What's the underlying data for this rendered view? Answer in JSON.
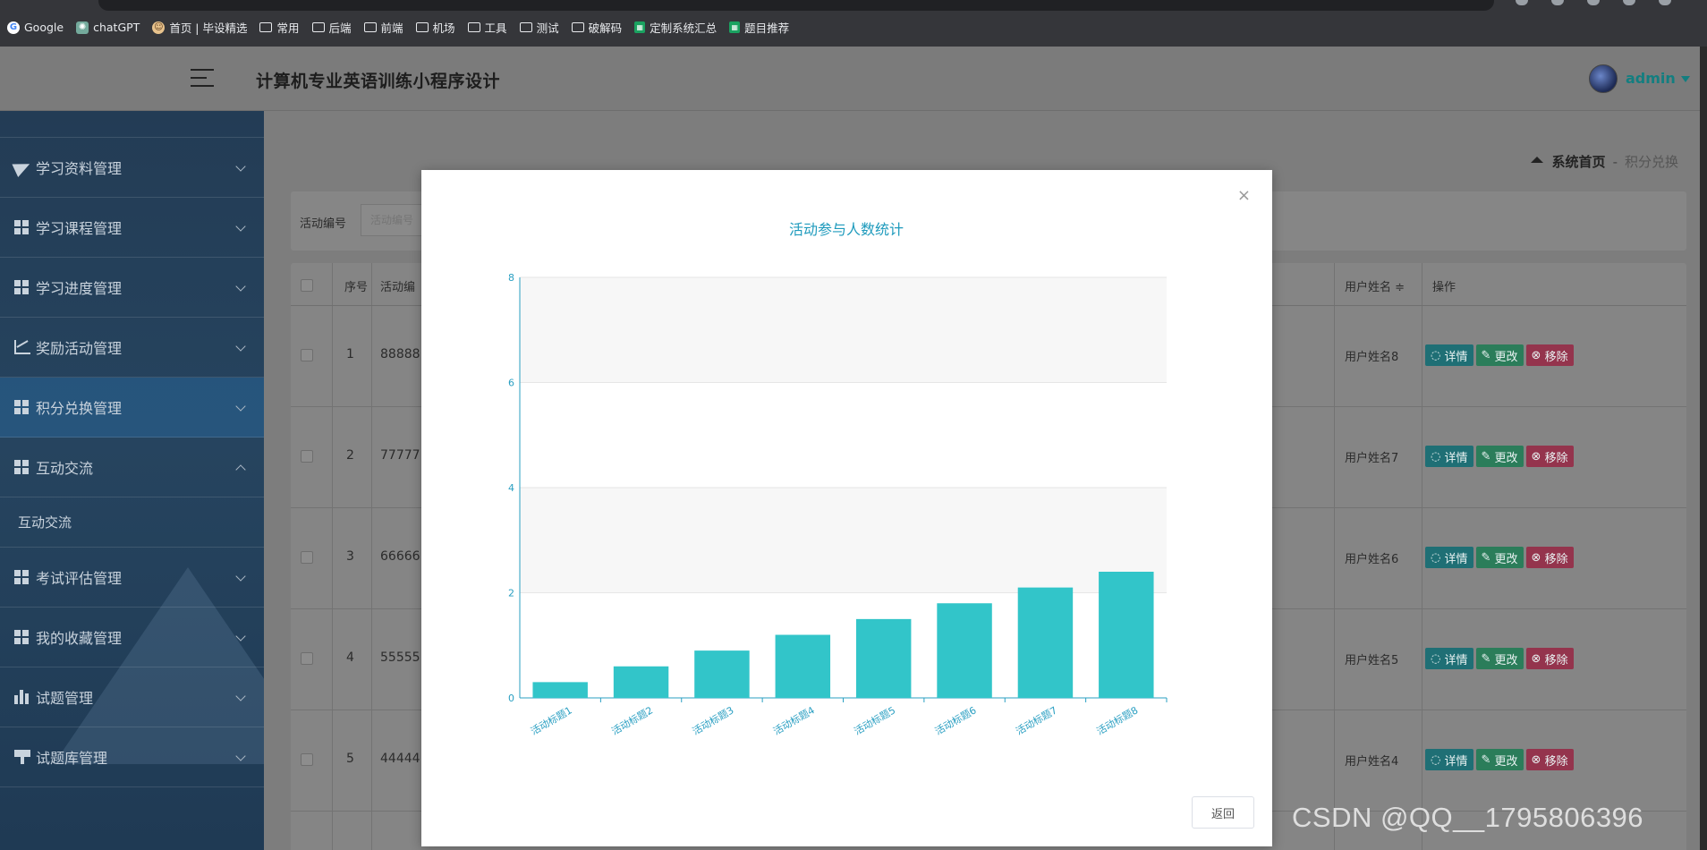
{
  "browser": {
    "bookmarks": [
      {
        "label": "Google",
        "icon": "google-icon"
      },
      {
        "label": "chatGPT",
        "icon": "chatgpt-icon"
      },
      {
        "label": "首页 | 毕设精选",
        "icon": "avatar-icon"
      },
      {
        "label": "常用",
        "icon": "folder-icon"
      },
      {
        "label": "后端",
        "icon": "folder-icon"
      },
      {
        "label": "前端",
        "icon": "folder-icon"
      },
      {
        "label": "机场",
        "icon": "folder-icon"
      },
      {
        "label": "工具",
        "icon": "folder-icon"
      },
      {
        "label": "测试",
        "icon": "folder-icon"
      },
      {
        "label": "破解码",
        "icon": "folder-icon"
      },
      {
        "label": "定制系统汇总",
        "icon": "sheet-icon"
      },
      {
        "label": "题目推荐",
        "icon": "sheet-icon"
      }
    ]
  },
  "header": {
    "title": "计算机专业英语训练小程序设计",
    "user": "admin"
  },
  "sidebar": {
    "items": [
      {
        "label": "学习资料管理",
        "icon": "paper-plane-icon"
      },
      {
        "label": "学习课程管理",
        "icon": "grid-icon"
      },
      {
        "label": "学习进度管理",
        "icon": "grid-icon"
      },
      {
        "label": "奖励活动管理",
        "icon": "trend-icon"
      },
      {
        "label": "积分兑换管理",
        "icon": "grid-icon"
      },
      {
        "label": "互动交流",
        "icon": "grid-icon"
      },
      {
        "label": "考试评估管理",
        "icon": "grid-icon"
      },
      {
        "label": "我的收藏管理",
        "icon": "grid-icon"
      },
      {
        "label": "试题管理",
        "icon": "bar-chart-icon"
      },
      {
        "label": "试题库管理",
        "icon": "signpost-icon"
      }
    ],
    "sub_item": "互动交流"
  },
  "breadcrumb": {
    "home": "系统首页",
    "separator": "-",
    "current": "积分兑换"
  },
  "search": {
    "label": "活动编号",
    "placeholder": "活动编号"
  },
  "table": {
    "headers": {
      "index": "序号",
      "activity": "活动编",
      "user": "用户姓名 ≑",
      "ops": "操作"
    },
    "rows": [
      {
        "index": "1",
        "code": "88888",
        "user": "用户姓名8"
      },
      {
        "index": "2",
        "code": "77777",
        "user": "用户姓名7"
      },
      {
        "index": "3",
        "code": "66666",
        "user": "用户姓名6"
      },
      {
        "index": "4",
        "code": "55555",
        "user": "用户姓名5"
      },
      {
        "index": "5",
        "code": "44444",
        "user": "用户姓名4"
      }
    ],
    "actions": {
      "detail": "详情",
      "edit": "更改",
      "delete": "移除"
    }
  },
  "modal": {
    "close": "×",
    "back": "返回"
  },
  "chart_data": {
    "type": "bar",
    "title": "活动参与人数统计",
    "categories": [
      "活动标题1",
      "活动标题2",
      "活动标题3",
      "活动标题4",
      "活动标题5",
      "活动标题6",
      "活动标题7",
      "活动标题8"
    ],
    "values": [
      0.3,
      0.6,
      0.9,
      1.2,
      1.5,
      1.8,
      2.1,
      2.4
    ],
    "ylim": [
      0,
      8
    ],
    "yticks": [
      0,
      2,
      4,
      6,
      8
    ],
    "bar_color": "#32c5c9",
    "grid": true
  },
  "watermark": "CSDN @QQ__1795806396"
}
